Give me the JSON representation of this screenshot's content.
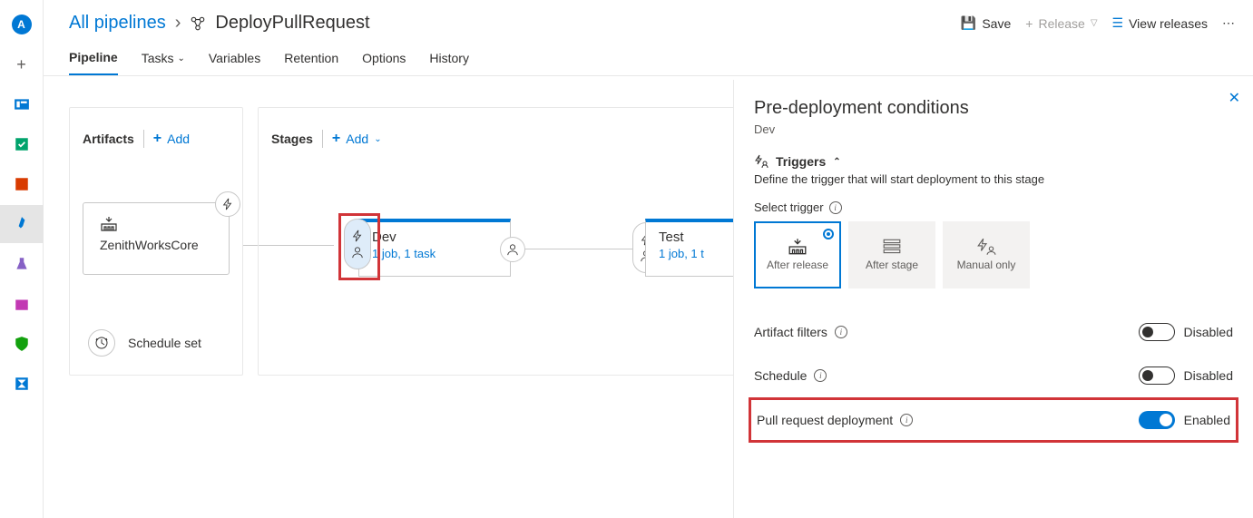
{
  "leftnav": {
    "badge": "A"
  },
  "breadcrumb": {
    "root": "All pipelines",
    "current": "DeployPullRequest"
  },
  "actions": {
    "save": "Save",
    "release": "Release",
    "view_releases": "View releases"
  },
  "tabs": {
    "pipeline": "Pipeline",
    "tasks": "Tasks",
    "variables": "Variables",
    "retention": "Retention",
    "options": "Options",
    "history": "History"
  },
  "artifacts": {
    "title": "Artifacts",
    "add": "Add",
    "name": "ZenithWorksCore",
    "schedule": "Schedule set"
  },
  "stages": {
    "title": "Stages",
    "add": "Add",
    "dev": {
      "name": "Dev",
      "sub": "1 job, 1 task"
    },
    "test": {
      "name": "Test",
      "sub": "1 job, 1 t"
    }
  },
  "panel": {
    "title": "Pre-deployment conditions",
    "stage": "Dev",
    "triggers_title": "Triggers",
    "triggers_desc": "Define the trigger that will start deployment to this stage",
    "select_trigger": "Select trigger",
    "trigger_options": {
      "after_release": "After release",
      "after_stage": "After stage",
      "manual_only": "Manual only"
    },
    "artifact_filters": "Artifact filters",
    "schedule": "Schedule",
    "pr_deployment": "Pull request deployment",
    "disabled": "Disabled",
    "enabled": "Enabled"
  }
}
